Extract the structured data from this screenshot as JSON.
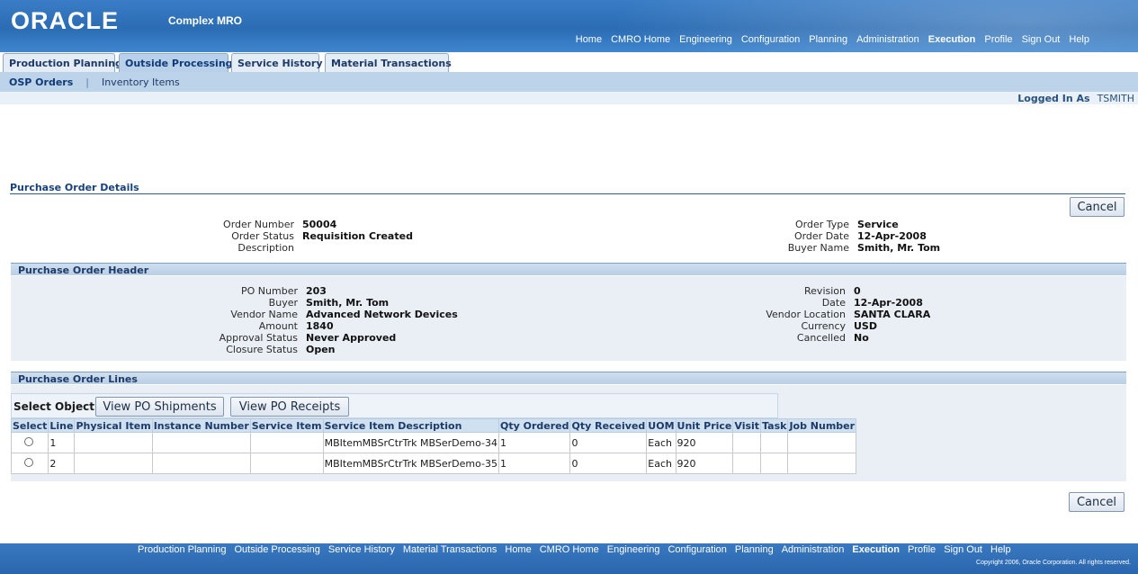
{
  "app": {
    "logo": "ORACLE",
    "name": "Complex MRO"
  },
  "global_nav": [
    "Home",
    "CMRO Home",
    "Engineering",
    "Configuration",
    "Planning",
    "Administration",
    "Execution",
    "Profile",
    "Sign Out",
    "Help"
  ],
  "global_nav_active": "Execution",
  "tabs": [
    "Production Planning",
    "Outside Processing",
    "Service History",
    "Material Transactions"
  ],
  "active_tab": "Outside Processing",
  "subnav": {
    "current": "OSP Orders",
    "separator": "|",
    "other": "Inventory Items"
  },
  "logged_in": {
    "label": "Logged In As",
    "user": "TSMITH"
  },
  "page_title": "Purchase Order Details",
  "cancel_label": "Cancel",
  "order": {
    "left": [
      {
        "label": "Order Number",
        "value": "50004"
      },
      {
        "label": "Order Status",
        "value": "Requisition Created"
      },
      {
        "label": "Description",
        "value": ""
      }
    ],
    "right": [
      {
        "label": "Order Type",
        "value": "Service"
      },
      {
        "label": "Order Date",
        "value": "12-Apr-2008"
      },
      {
        "label": "Buyer Name",
        "value": "Smith, Mr. Tom"
      }
    ]
  },
  "po_header": {
    "title": "Purchase Order Header",
    "left": [
      {
        "label": "PO Number",
        "value": "203"
      },
      {
        "label": "Buyer",
        "value": "Smith, Mr. Tom"
      },
      {
        "label": "Vendor Name",
        "value": "Advanced Network Devices"
      },
      {
        "label": "Amount",
        "value": "1840"
      },
      {
        "label": "Approval Status",
        "value": "Never Approved"
      },
      {
        "label": "Closure Status",
        "value": "Open"
      }
    ],
    "right": [
      {
        "label": "Revision",
        "value": "0"
      },
      {
        "label": "Date",
        "value": "12-Apr-2008"
      },
      {
        "label": "Vendor Location",
        "value": "SANTA CLARA"
      },
      {
        "label": "Currency",
        "value": "USD"
      },
      {
        "label": "Cancelled",
        "value": "No"
      }
    ]
  },
  "po_lines": {
    "title": "Purchase Order Lines",
    "select_label": "Select Object:",
    "view_shipments": "View PO Shipments",
    "view_receipts": "View PO Receipts",
    "columns": [
      "Select",
      "Line",
      "Physical Item",
      "Instance Number",
      "Service Item",
      "Service Item Description",
      "Qty Ordered",
      "Qty Received",
      "UOM",
      "Unit Price",
      "Visit",
      "Task",
      "Job Number"
    ],
    "rows": [
      [
        "",
        "1",
        "",
        "",
        "",
        "MBItemMBSrCtrTrk MBSerDemo-34",
        "1",
        "0",
        "Each",
        "920",
        "",
        "",
        ""
      ],
      [
        "",
        "2",
        "",
        "",
        "",
        "MBItemMBSrCtrTrk MBSerDemo-35",
        "1",
        "0",
        "Each",
        "920",
        "",
        "",
        ""
      ]
    ]
  },
  "footer_nav": [
    "Production Planning",
    "Outside Processing",
    "Service History",
    "Material Transactions",
    "Home",
    "CMRO Home",
    "Engineering",
    "Configuration",
    "Planning",
    "Administration",
    "Execution",
    "Profile",
    "Sign Out",
    "Help"
  ],
  "footer_nav_active": "Execution",
  "copyright": "Copyright 2006, Oracle Corporation. All rights reserved."
}
